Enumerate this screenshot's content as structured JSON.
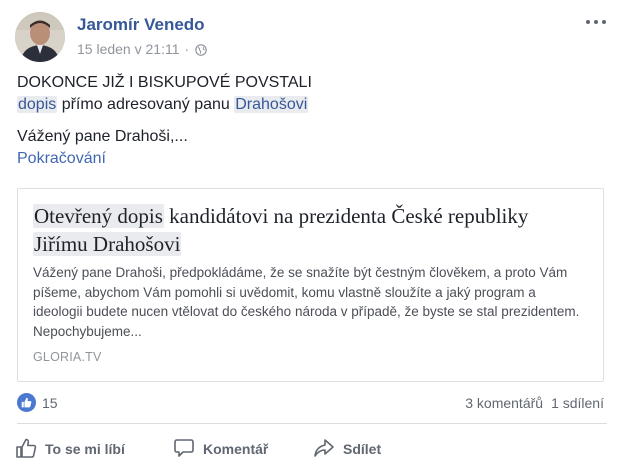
{
  "post": {
    "author": "Jaromír Venedo",
    "timestamp": "15 leden v 21:11",
    "separator": "·",
    "privacy_icon": "globe-icon",
    "more_icon": "ellipsis-icon"
  },
  "body": {
    "line1": "DOKONCE JIŽ I BISKUPOVÉ POVSTALI",
    "line2_link1": "dopis",
    "line2_middle": " přímo adresovaný panu ",
    "line2_link2": "Drahošovi",
    "line3": "Vážený pane Drahoši,...",
    "see_more": "Pokračování"
  },
  "link_preview": {
    "title_part1": "Otevřený dopis",
    "title_part2": " kandidátovi na prezidenta České republiky ",
    "title_part3": "Jiřímu Drahošovi",
    "description": "Vážený pane Drahoši, předpokládáme, že se snažíte být čestným člověkem, a proto Vám píšeme, abychom Vám pomohli si uvědomit, komu vlastně sloužíte a jaký program a ideologii budete nucen vtělovat do českého národa v případě, že byste se stal prezidentem. Nepochybujeme...",
    "domain": "GLORIA.TV"
  },
  "stats": {
    "like_count": "15",
    "comments": "3 komentářů",
    "shares": "1 sdílení"
  },
  "actions": {
    "like": "To se mi líbí",
    "comment": "Komentář",
    "share": "Sdílet"
  },
  "colors": {
    "link": "#365899",
    "like_blue": "#4b78d1",
    "muted": "#90949c"
  }
}
